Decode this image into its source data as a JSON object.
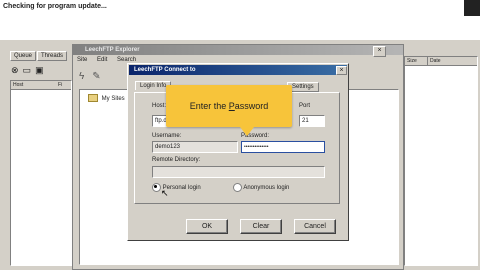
{
  "status_text": "Checking for program update...",
  "main_window": {
    "tabs": [
      "Queue",
      "Threads"
    ],
    "columns": [
      "Host",
      "Fi"
    ],
    "right_columns": [
      "Size",
      "Date"
    ]
  },
  "explorer": {
    "title": "LeechFTP Explorer",
    "menu": [
      "Site",
      "Edit",
      "Search"
    ],
    "tree_item": "My Sites"
  },
  "dialog": {
    "title": "LeechFTP Connect to",
    "tabs": [
      "Login Info",
      "Settings"
    ],
    "host_label": "Host:",
    "host_value": "ftp.d",
    "port_label": "Port",
    "port_value": "21",
    "username_label": "Username:",
    "username_value": "demo123",
    "password_label": "Password:",
    "password_value": "••••••••••••••",
    "remote_dir_label": "Remote Directory:",
    "remote_dir_value": "",
    "personal_login": "Personal login",
    "anonymous_login": "Anonymous login",
    "ok": "OK",
    "clear": "Clear",
    "cancel": "Cancel"
  },
  "callout": {
    "text_before": "Enter the ",
    "text_underline": "P",
    "text_after": "assword"
  },
  "colors": {
    "callout": "#f7c43a",
    "titlebar": "#0a246a",
    "face": "#d4d0c8"
  }
}
